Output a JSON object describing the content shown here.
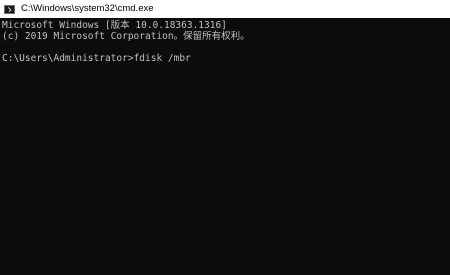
{
  "window": {
    "title": "C:\\Windows\\system32\\cmd.exe",
    "icon": "cmd-icon"
  },
  "console": {
    "lines": [
      "Microsoft Windows [版本 10.0.18363.1316]",
      "(c) 2019 Microsoft Corporation。保留所有权利。"
    ],
    "prompt": "C:\\Users\\Administrator>",
    "command": "fdisk /mbr"
  },
  "colors": {
    "background": "#0c0c0c",
    "text": "#c0c0c0",
    "titlebar": "#ffffff"
  }
}
